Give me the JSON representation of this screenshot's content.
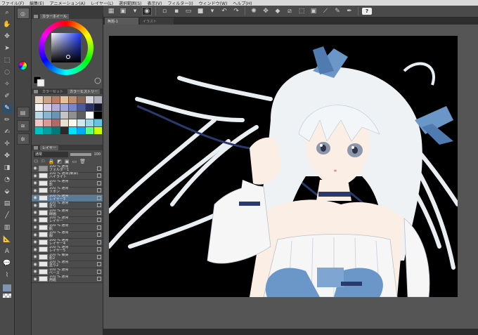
{
  "menu": [
    "ファイル(F)",
    "編集(E)",
    "アニメーション(A)",
    "レイヤー(L)",
    "選択範囲(S)",
    "表示(V)",
    "フィルター(I)",
    "ウィンドウ(W)",
    "ヘルプ(H)"
  ],
  "tabs": [
    {
      "label": "無題-1"
    },
    {
      "label": "イラスト"
    }
  ],
  "toolbar": {
    "help_label": "?"
  },
  "color_panel": {
    "label": "カラーホイール"
  },
  "palette_panel": {
    "labels": [
      "カラーセット",
      "カラーヒストリー"
    ]
  },
  "layer_panel": {
    "label": "レイヤー",
    "blend_mode": "通常",
    "opacity": "100"
  },
  "layers": [
    {
      "name": "100 % 通常\nフォルダー1",
      "folder": true,
      "selected": false
    },
    {
      "name": "100 % 通常(乗算)\nハイライト",
      "folder": false,
      "selected": false
    },
    {
      "name": "100 % 通常\n影",
      "folder": false,
      "selected": false
    },
    {
      "name": "100 % 通常\nリボン",
      "folder": false,
      "selected": false
    },
    {
      "name": "100 % 通常\nレイヤー3",
      "folder": false,
      "selected": true
    },
    {
      "name": "100 % 通常\n塗り",
      "folder": false,
      "selected": false
    },
    {
      "name": "100 % 通常\n線画",
      "folder": false,
      "selected": false
    },
    {
      "name": "100 % 通常\nレイヤー",
      "folder": false,
      "selected": false
    },
    {
      "name": "100 % 通常\n肌",
      "folder": false,
      "selected": false
    },
    {
      "name": "100 % 通常\n服",
      "folder": false,
      "selected": false
    },
    {
      "name": "100 % 通常\nレイヤー4",
      "folder": false,
      "selected": false
    },
    {
      "name": "100 % 通常\nレイヤー5",
      "folder": false,
      "selected": false
    },
    {
      "name": "100 % 乗算\n影2",
      "folder": false,
      "selected": false
    },
    {
      "name": "100 % 通常\n塗り2",
      "folder": false,
      "selected": false
    },
    {
      "name": "100 % 通常\nベース",
      "folder": false,
      "selected": false
    },
    {
      "name": "100 % 通常\n用紙",
      "folder": false,
      "selected": false
    }
  ],
  "swatches": [
    "#e8d7c0",
    "#caa48a",
    "#b97e63",
    "#e6c29a",
    "#c08f6e",
    "#8c6a5b",
    "#d7d7e0",
    "#b2b2bf",
    "#f6f6f6",
    "#d8d0e8",
    "#b7acd6",
    "#a0a8d8",
    "#7a86c7",
    "#4c5a9c",
    "#2b3364",
    "#111326",
    "#b8d8e6",
    "#8ab4d0",
    "#6a94b6",
    "#c4c4c4",
    "#909090",
    "#5e5e5e",
    "#ffffff",
    "#000000",
    "#f0c8c8",
    "#d89a9a",
    "#b06a6a",
    "#e8e0d0",
    "#fffaf0",
    "#cfe7ef",
    "#9fd6e8",
    "#66c4e0",
    "#00c4c4",
    "#00a0a0",
    "#007a7a",
    "#2a2a2a",
    "#00e0ff",
    "#00aaff",
    "#55ff88",
    "#ccff00"
  ],
  "colors": {
    "accent": "#5a7a95",
    "canvas_bg": "#000000",
    "ribbon": "#6a96c8"
  }
}
